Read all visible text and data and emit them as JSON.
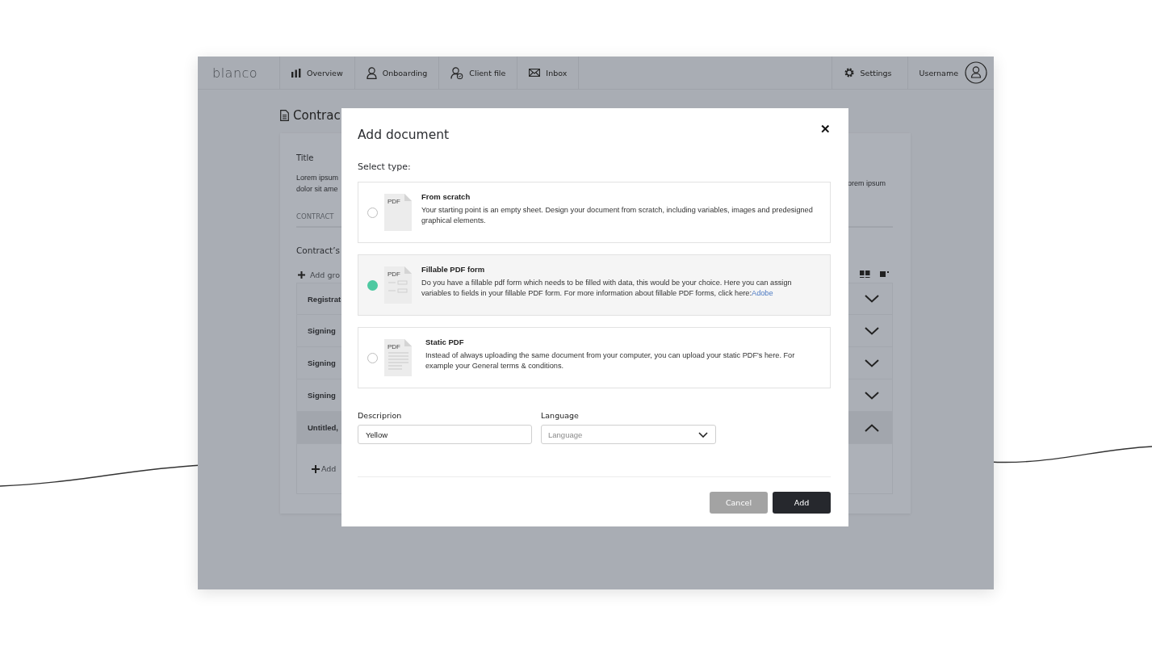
{
  "nav": {
    "logo": "blanco",
    "tabs": [
      {
        "label": "Overview",
        "selected": false
      },
      {
        "label": "Onboarding",
        "selected": false
      },
      {
        "label": "Client file",
        "selected": false
      },
      {
        "label": "Inbox",
        "selected": false
      }
    ],
    "settings": "Settings",
    "user": "Username"
  },
  "page": {
    "title": "Contrac",
    "title_label": "Title",
    "lorem_left": [
      "Lorem ipsum",
      "dolor sit ame"
    ],
    "lorem_right": "orem ipsum",
    "section": "CONTRACT",
    "subheading": "Contract’s",
    "add_group": "Add gro",
    "rows": [
      {
        "label": "Registrat",
        "expanded": false
      },
      {
        "label": "Signing",
        "expanded": false
      },
      {
        "label": "Signing",
        "expanded": false
      },
      {
        "label": "Signing",
        "expanded": false
      },
      {
        "label": "Untitled,",
        "expanded": true
      }
    ],
    "add_item": "Add"
  },
  "modal": {
    "title": "Add document",
    "close": "✕",
    "select_label": "Select type:",
    "options": [
      {
        "kind": "blank",
        "icon_label": "PDF",
        "title": "From scratch",
        "description": "Your starting point is an empty sheet. Design your document from scratch, including variables, images and predesigned graphical elements.",
        "selected": false
      },
      {
        "kind": "form",
        "icon_label": "PDF",
        "title": "Fillable PDF form",
        "description": "Do you have a fillable pdf form which needs to be filled with data, this would be your choice. Here you can assign variables to fields in your fillable PDF form. For more information about fillable PDF forms, click here:",
        "link": "Adobe",
        "selected": true
      },
      {
        "kind": "lines",
        "icon_label": "PDF",
        "title": "Static PDF",
        "description": "Instead of always uploading the same document from your computer, you can upload your static PDF's here. For example your General terms & conditions.",
        "selected": false
      }
    ],
    "description_label": "Descriprion",
    "description_value": "Yellow",
    "language_label": "Language",
    "language_placeholder": "Language",
    "buttons": [
      {
        "label": "Cancel",
        "kind": "secondary",
        "disabled": true
      },
      {
        "label": "Add",
        "kind": "primary",
        "disabled": false
      }
    ]
  }
}
